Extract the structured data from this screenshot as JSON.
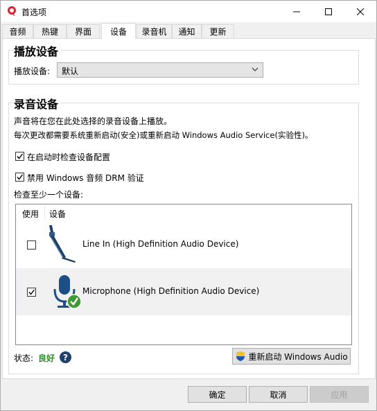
{
  "window": {
    "title": "首选项"
  },
  "tabs": [
    {
      "label": "音频"
    },
    {
      "label": "热键"
    },
    {
      "label": "界面"
    },
    {
      "label": "设备"
    },
    {
      "label": "录音机"
    },
    {
      "label": "通知"
    },
    {
      "label": "更新"
    }
  ],
  "active_tab": "设备",
  "playback": {
    "group_title": "播放设备",
    "device_label": "播放设备:",
    "device_value": "默认"
  },
  "recording": {
    "group_title": "录音设备",
    "description_1": "声音将在您在此处选择的录音设备上播放。",
    "description_2": "每次更改都需要系统重新启动(安全)或重新启动 Windows Audio Service(实验性)。",
    "check_on_startup_label": "在启动时检查设备配置",
    "check_on_startup": true,
    "disable_drm_label": "禁用 Windows 音频 DRM 验证",
    "disable_drm": true,
    "check_at_least_label": "检查至少一个设备:",
    "columns": {
      "use": "使用",
      "device": "设备"
    },
    "devices": [
      {
        "name": "Line In (High Definition Audio Device)",
        "checked": false,
        "icon": "line-in-jack-icon"
      },
      {
        "name": "Microphone (High Definition Audio Device)",
        "checked": true,
        "icon": "microphone-ok-icon"
      }
    ],
    "status_label": "状态:",
    "status_value": "良好",
    "restart_button": "重新启动 Windows Audio"
  },
  "footer": {
    "ok": "确定",
    "cancel": "取消",
    "apply": "应用"
  },
  "colors": {
    "status_good": "#2e8b2e",
    "help_icon": "#1f3f6e",
    "alt_row": "#f1f1f1"
  }
}
